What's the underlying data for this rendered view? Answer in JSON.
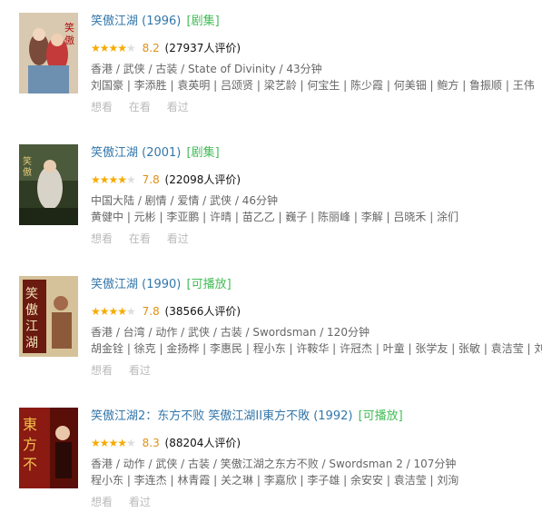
{
  "items": [
    {
      "title": "笑傲江湖 (1996)",
      "tag": "[剧集]",
      "rating": 4.0,
      "score": "8.2",
      "votes": "(27937人评价)",
      "meta": "香港 / 武侠 / 古装 / State of Divinity / 43分钟",
      "cast": "刘国豪 | 李添胜 | 袁英明 | 吕颂贤 | 梁艺龄 | 何宝生 | 陈少霞 | 何美钿 | 鲍方 | 鲁振顺 | 王伟",
      "actions": [
        "想看",
        "在看",
        "看过"
      ],
      "poster": {
        "title": "笑傲江湖",
        "bg": "#d9c9b0"
      }
    },
    {
      "title": "笑傲江湖 (2001)",
      "tag": "[剧集]",
      "rating": 4.0,
      "score": "7.8",
      "votes": "(22098人评价)",
      "meta": "中国大陆 / 剧情 / 爱情 / 武侠 / 46分钟",
      "cast": "黄健中 | 元彬 | 李亚鹏 | 许晴 | 苗乙乙 | 巍子 | 陈丽峰 | 李解 | 吕晓禾 | 涂们",
      "actions": [
        "想看",
        "在看",
        "看过"
      ],
      "poster": {
        "title": "笑傲江湖",
        "bg": "#3c4a2c"
      }
    },
    {
      "title": "笑傲江湖 (1990)",
      "tag": "[可播放]",
      "rating": 4.0,
      "score": "7.8",
      "votes": "(38566人评价)",
      "meta": "香港 / 台湾 / 动作 / 武侠 / 古装 / Swordsman / 120分钟",
      "cast": "胡金铨 | 徐克 | 金扬桦 | 李惠民 | 程小东 | 许鞍华 | 许冠杰 | 叶童 | 张学友 | 张敏 | 袁洁莹 | 刘兆铭",
      "actions": [
        "想看",
        "看过"
      ],
      "poster": {
        "title": "笑傲江湖",
        "bg": "#c9b48a"
      }
    },
    {
      "title": "笑傲江湖2：东方不败 笑傲江湖II東方不敗 (1992)",
      "tag": "[可播放]",
      "rating": 4.5,
      "score": "8.3",
      "votes": "(88204人评价)",
      "meta": "香港 / 动作 / 武侠 / 古装 / 笑傲江湖之东方不败 / Swordsman 2 / 107分钟",
      "cast": "程小东 | 李连杰 | 林青霞 | 关之琳 | 李嘉欣 | 李子雄 | 余安安 | 袁洁莹 | 刘洵",
      "actions": [
        "想看",
        "看过"
      ],
      "poster": {
        "title": "東方不敗",
        "bg": "#8a1a12"
      }
    }
  ],
  "colors": {
    "link": "#3377aa",
    "tag_series": "#3377aa",
    "tag_playable": "#42bd56",
    "star": "#f6ab00",
    "score": "#e09015",
    "meta": "#666666",
    "action": "#bbbbbb"
  }
}
